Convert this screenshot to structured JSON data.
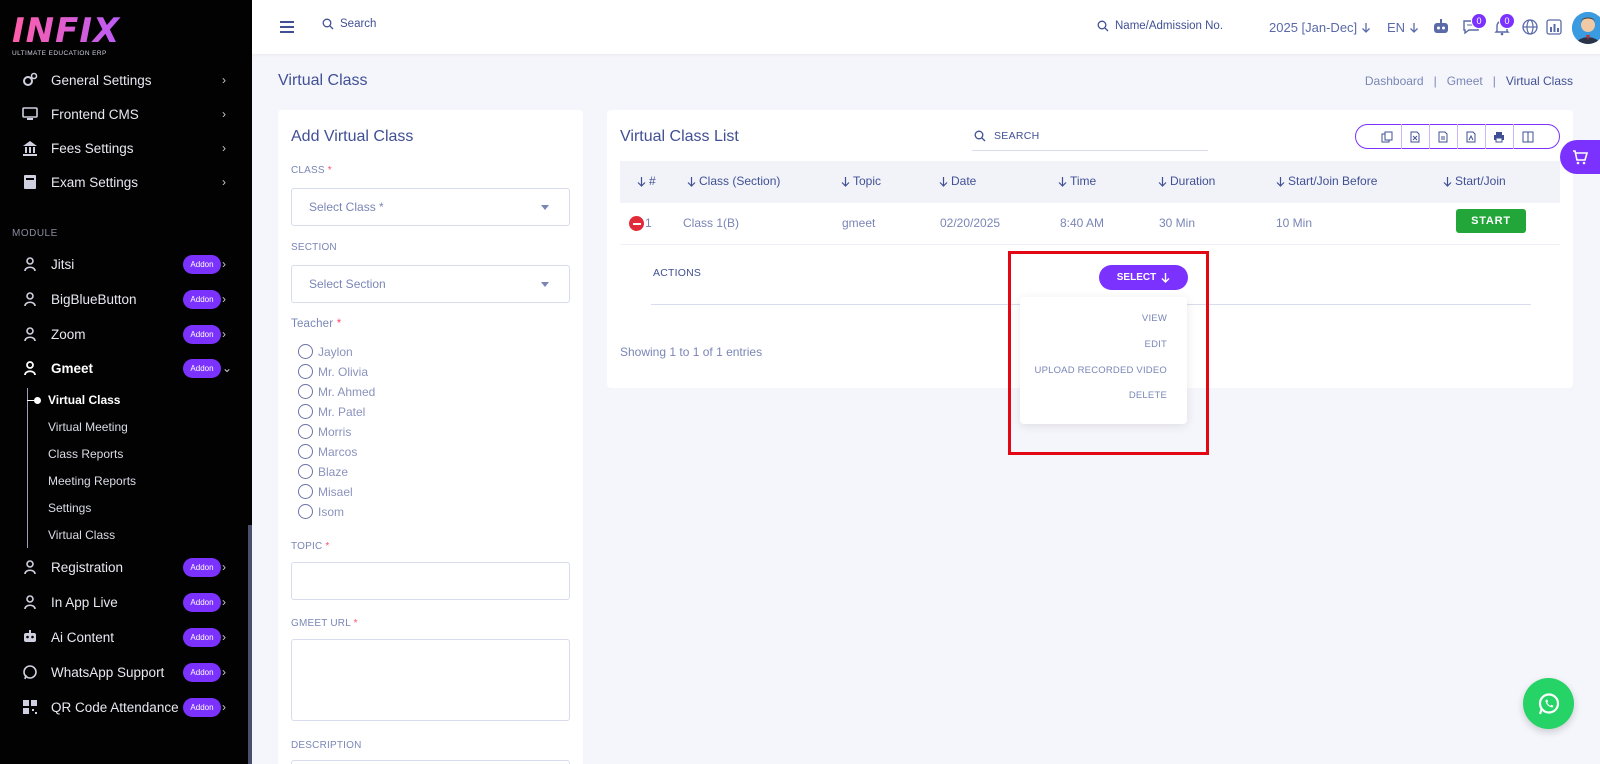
{
  "brand": {
    "logo_text": "INFIX",
    "tagline": "ULTIMATE EDUCATION ERP"
  },
  "sidebar": {
    "top_items": [
      {
        "label": "General Settings",
        "icon": "gears-icon"
      },
      {
        "label": "Frontend CMS",
        "icon": "monitor-icon"
      },
      {
        "label": "Fees Settings",
        "icon": "bank-icon"
      },
      {
        "label": "Exam Settings",
        "icon": "book-icon"
      }
    ],
    "module_heading": "MODULE",
    "modules": [
      {
        "label": "Jitsi",
        "badge": "Addon"
      },
      {
        "label": "BigBlueButton",
        "badge": "Addon"
      },
      {
        "label": "Zoom",
        "badge": "Addon"
      },
      {
        "label": "Gmeet",
        "badge": "Addon"
      },
      {
        "label": "Registration",
        "badge": "Addon"
      },
      {
        "label": "In App Live",
        "badge": "Addon"
      },
      {
        "label": "Ai Content",
        "badge": "Addon"
      },
      {
        "label": "WhatsApp Support",
        "badge": "Addon"
      },
      {
        "label": "QR Code Attendance",
        "badge": "Addon"
      }
    ],
    "gmeet_submenu": [
      "Virtual Class",
      "Virtual Meeting",
      "Class Reports",
      "Meeting Reports",
      "Settings",
      "Virtual Class"
    ]
  },
  "header": {
    "search_label": "Search",
    "student_search": "Name/Admission No.",
    "year": "2025 [Jan-Dec]",
    "lang": "EN",
    "chat_count": "0",
    "notif_count": "0"
  },
  "page": {
    "title": "Virtual Class",
    "breadcrumb": [
      "Dashboard",
      "|",
      "Gmeet",
      "|",
      "Virtual Class"
    ]
  },
  "form": {
    "title": "Add Virtual Class",
    "class_label": "CLASS",
    "class_placeholder": "Select Class *",
    "section_label": "SECTION",
    "section_placeholder": "Select Section",
    "teacher_label": "Teacher",
    "teachers": [
      "Jaylon",
      "Mr. Olivia",
      "Mr. Ahmed",
      "Mr. Patel",
      "Morris",
      "Marcos",
      "Blaze",
      "Misael",
      "Isom"
    ],
    "topic_label": "TOPIC",
    "gmeet_url_label": "GMEET URL",
    "description_label": "DESCRIPTION",
    "required_mark": "*"
  },
  "list": {
    "title": "Virtual Class List",
    "search_placeholder": "SEARCH",
    "columns": [
      "#",
      "Class (Section)",
      "Topic",
      "Date",
      "Time",
      "Duration",
      "Start/Join Before",
      "Start/Join"
    ],
    "rows": [
      {
        "no": "1",
        "class_section": "Class 1(B)",
        "topic": "gmeet",
        "date": "02/20/2025",
        "time": "8:40 AM",
        "duration": "30 Min",
        "before": "10 Min",
        "action": "START"
      }
    ],
    "actions_label": "ACTIONS",
    "select_label": "SELECT",
    "dropdown": [
      "VIEW",
      "EDIT",
      "UPLOAD RECORDED VIDEO",
      "DELETE"
    ],
    "entries": "Showing 1 to 1 of 1 entries",
    "toolbar_icons": [
      "copy-icon",
      "excel-icon",
      "csv-icon",
      "pdf-icon",
      "print-icon",
      "columns-icon"
    ]
  },
  "colors": {
    "accent": "#7c32ff",
    "primary_text": "#415094",
    "start_green": "#22a63a",
    "highlight_red": "#e30613"
  }
}
